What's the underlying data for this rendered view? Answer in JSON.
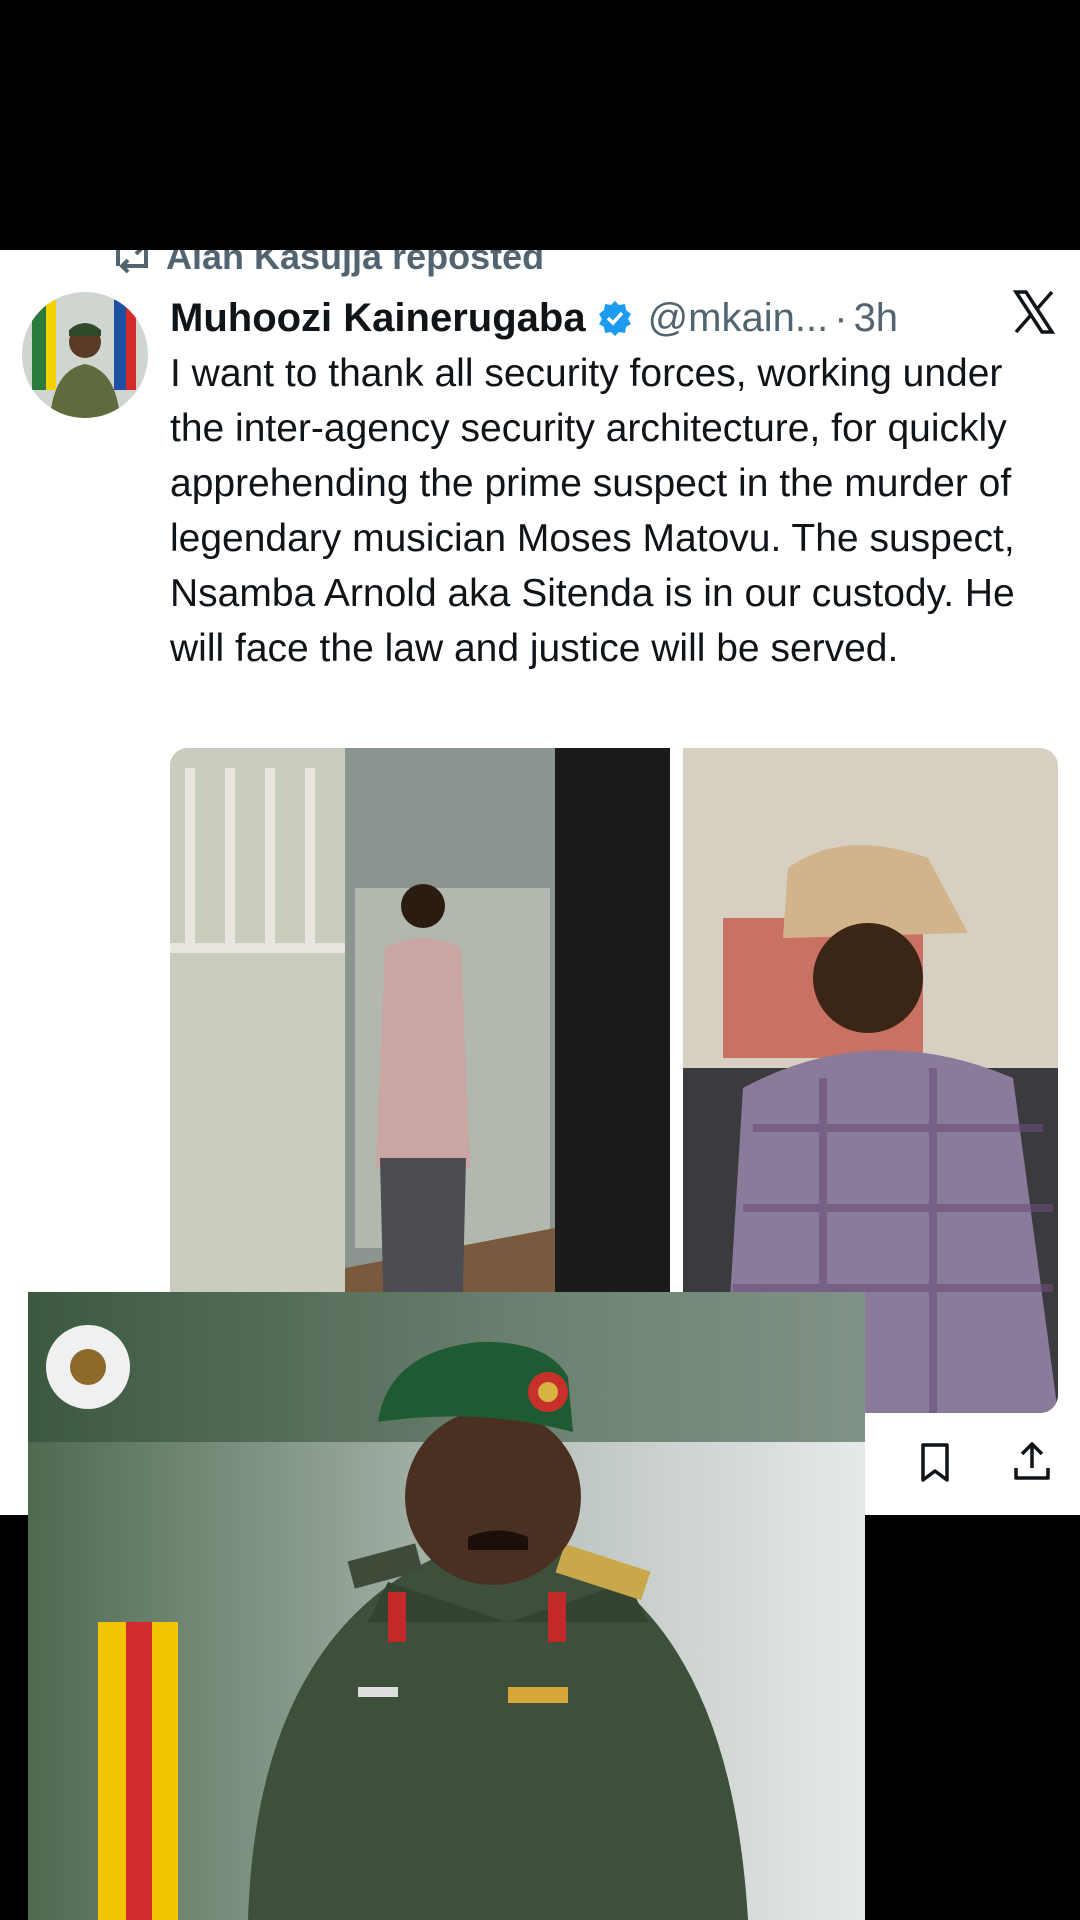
{
  "repost": {
    "text": "Alan Kasujja reposted",
    "icon": "repost-icon"
  },
  "tweet": {
    "author_name": "Muhoozi Kainerugaba",
    "verified": true,
    "handle": "@mkain...",
    "separator": "·",
    "time": "3h",
    "text": "I want to thank all security forces, working under the inter-agency security architecture, for quickly apprehending the prime suspect in the murder of legendary musician Moses Matovu. The suspect, Nsamba Arnold aka Sitenda is in our custody. He will face the law and justice will be served."
  },
  "actions": [
    "bookmark-icon",
    "share-icon"
  ],
  "colors": {
    "card_bg": "#ffffff",
    "text": "#0f1419",
    "secondary": "#536471",
    "verified": "#1d9bf0",
    "page_bg": "#000000"
  }
}
